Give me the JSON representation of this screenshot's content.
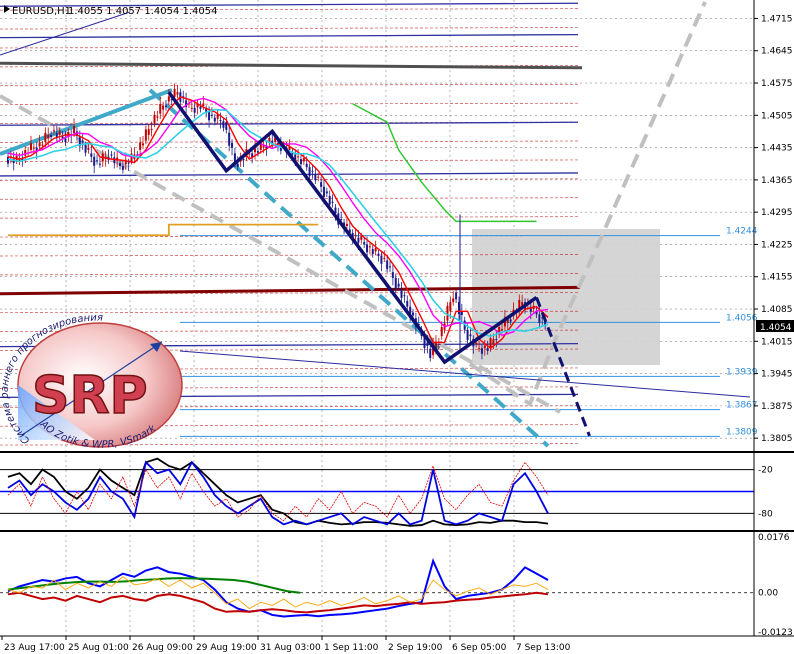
{
  "header": {
    "symbol": "EURUSD,H1",
    "ohlc": "1.4055 1.4057 1.4054 1.4054"
  },
  "logo": {
    "letters": "SRP",
    "arc_top": "Система раннего прогнозирования",
    "arc_bottom": "AO Zotik & WPR, VSmark"
  },
  "colors": {
    "background": "#ffffff",
    "grid": "#000000",
    "bull_candle": "#c00000",
    "bear_candle": "#1a1a8c",
    "price_fast_ma": "#ff0000",
    "price_slow_ma": "#ff00ff",
    "price_cyan_ma": "#2fd0e8",
    "zigzag": "#101070",
    "trend_dashed_blue": "#40a8c8",
    "trend_dashed_grey": "#c0c0c0",
    "step_line_green": "#2ec82e",
    "step_line_orange": "#e0a020",
    "resistance_brown": "#800000",
    "levels_red_dashed": "#c00000",
    "levels_blue": "#3030a0",
    "levels_light_blue": "#3090e0",
    "box": "#c8c8c8",
    "current_price_bg": "#000000",
    "current_price_text": "#ffffff",
    "wpr_black": "#000000",
    "wpr_blue": "#0000e0",
    "wpr_red": "#e00000",
    "osc_blue": "#0000ff",
    "osc_green": "#008000",
    "osc_red": "#c00000",
    "osc_orange": "#ffa500"
  },
  "chart_data": [
    {
      "type": "candlestick",
      "ylim": [
        1.3775,
        1.4755
      ],
      "y_ticks": [
        "1.4715",
        "1.4645",
        "1.4575",
        "1.4505",
        "1.4435",
        "1.4365",
        "1.4295",
        "1.4225",
        "1.4155",
        "1.4085",
        "1.4015",
        "1.3945",
        "1.3875",
        "1.3805"
      ],
      "x_ticks": [
        "23 Aug 17:00",
        "25 Aug 01:00",
        "26 Aug 09:00",
        "29 Aug 19:00",
        "31 Aug 03:00",
        "1 Sep 11:00",
        "2 Sep 19:00",
        "6 Sep 05:00",
        "7 Sep 13:00"
      ],
      "current_price": "1.4054",
      "level_labels": [
        {
          "label": "1.4244",
          "value": 1.4244
        },
        {
          "label": "1.4056",
          "value": 1.4056
        },
        {
          "label": "1.3939",
          "value": 1.3939
        },
        {
          "label": "1.3867",
          "value": 1.3867
        },
        {
          "label": "1.3809",
          "value": 1.3809
        }
      ],
      "resistance_level": {
        "from": 1.4118,
        "to": 1.4132
      },
      "long_term_line": {
        "from": 1.4618,
        "to": 1.4608
      },
      "price_path": [
        1.4415,
        1.4405,
        1.443,
        1.444,
        1.447,
        1.4455,
        1.447,
        1.443,
        1.44,
        1.442,
        1.4395,
        1.441,
        1.445,
        1.45,
        1.4535,
        1.4555,
        1.452,
        1.4525,
        1.45,
        1.449,
        1.44,
        1.442,
        1.443,
        1.445,
        1.444,
        1.442,
        1.44,
        1.437,
        1.433,
        1.428,
        1.425,
        1.423,
        1.421,
        1.419,
        1.414,
        1.409,
        1.404,
        1.3985,
        1.404,
        1.412,
        1.404,
        1.4,
        1.4,
        1.404,
        1.407,
        1.41,
        1.408,
        1.4054
      ],
      "zigzag": [
        {
          "bar": 14,
          "price": 1.4555
        },
        {
          "bar": 19,
          "price": 1.4385
        },
        {
          "bar": 23,
          "price": 1.447
        },
        {
          "bar": 38,
          "price": 1.397
        },
        {
          "bar": 46,
          "price": 1.411
        },
        {
          "bar": 48,
          "price": 1.381
        }
      ],
      "green_step_path": [
        {
          "bar": 30,
          "price": 1.453
        },
        {
          "bar": 33,
          "price": 1.449
        },
        {
          "bar": 34,
          "price": 1.443
        },
        {
          "bar": 36,
          "price": 1.436
        },
        {
          "bar": 38,
          "price": 1.43
        },
        {
          "bar": 39,
          "price": 1.4275
        },
        {
          "bar": 46,
          "price": 1.4275
        }
      ],
      "orange_step_path": [
        {
          "bar": 0,
          "price": 1.4245
        },
        {
          "bar": 14,
          "price": 1.4245
        },
        {
          "bar": 14,
          "price": 1.4268
        },
        {
          "bar": 27,
          "price": 1.4268
        }
      ]
    },
    {
      "type": "line",
      "name_pane": "wpr",
      "y_ticks": [
        "-20",
        "-80"
      ],
      "series": [
        {
          "color_key": "wpr_black",
          "values": [
            -30,
            -25,
            -40,
            -20,
            -30,
            -50,
            -60,
            -45,
            -20,
            -35,
            -45,
            -55,
            -10,
            -5,
            -15,
            -20,
            -10,
            -25,
            -40,
            -55,
            -65,
            -60,
            -55,
            -75,
            -80,
            -92,
            -95,
            -90,
            -93,
            -95,
            -94,
            -92,
            -92,
            -93,
            -95,
            -97,
            -96,
            -90,
            -95,
            -96,
            -95,
            -92,
            -93,
            -90,
            -90,
            -92,
            -92,
            -94
          ]
        },
        {
          "color_key": "wpr_blue",
          "values": [
            -45,
            -35,
            -55,
            -40,
            -50,
            -65,
            -75,
            -60,
            -30,
            -50,
            -60,
            -85,
            -10,
            -25,
            -20,
            -40,
            -10,
            -30,
            -55,
            -70,
            -80,
            -70,
            -60,
            -85,
            -95,
            -90,
            -95,
            -90,
            -85,
            -80,
            -95,
            -85,
            -90,
            -95,
            -80,
            -95,
            -90,
            -20,
            -90,
            -95,
            -90,
            -80,
            -85,
            -90,
            -40,
            -25,
            -50,
            -80
          ]
        },
        {
          "color_key": "wpr_red",
          "values": [
            -55,
            -40,
            -70,
            -30,
            -60,
            -80,
            -50,
            -75,
            -40,
            -60,
            -30,
            -70,
            -20,
            -45,
            -30,
            -60,
            -25,
            -50,
            -70,
            -60,
            -85,
            -75,
            -55,
            -80,
            -90,
            -70,
            -85,
            -60,
            -75,
            -50,
            -80,
            -65,
            -70,
            -85,
            -55,
            -80,
            -60,
            -15,
            -60,
            -75,
            -55,
            -40,
            -65,
            -70,
            -35,
            -10,
            -30,
            -55
          ]
        }
      ]
    },
    {
      "type": "line",
      "name_pane": "oscillator",
      "y_ticks": [
        "0.0176",
        "0.00",
        "-0.0123"
      ],
      "series": [
        {
          "color_key": "osc_blue",
          "values": [
            0.0005,
            0.002,
            0.003,
            0.004,
            0.0035,
            0.0045,
            0.005,
            0.003,
            0.002,
            0.004,
            0.006,
            0.005,
            0.007,
            0.008,
            0.0065,
            0.006,
            0.005,
            0.004,
            0.001,
            -0.003,
            -0.005,
            -0.006,
            -0.0055,
            -0.007,
            -0.0075,
            -0.0072,
            -0.007,
            -0.0074,
            -0.007,
            -0.0068,
            -0.0065,
            -0.006,
            -0.0055,
            -0.005,
            -0.0042,
            -0.0035,
            -0.003,
            0.01,
            0.002,
            -0.002,
            -0.001,
            -0.0005,
            0.0,
            0.001,
            0.004,
            0.008,
            0.006,
            0.004
          ]
        },
        {
          "color_key": "osc_green",
          "values": [
            0.001,
            0.0015,
            0.002,
            0.0025,
            0.003,
            0.0033,
            0.0035,
            0.0035,
            0.0034,
            0.0036,
            0.004,
            0.0042,
            0.0045,
            0.0046,
            0.0045,
            0.0044,
            0.0042,
            0.004,
            0.0035,
            0.0025,
            0.0015,
            0.0005,
            0.0
          ]
        },
        {
          "color_key": "osc_red",
          "values": [
            -0.0005,
            0.0,
            -0.001,
            -0.002,
            -0.0015,
            -0.0025,
            -0.001,
            -0.002,
            -0.003,
            -0.0015,
            -0.001,
            -0.002,
            -0.0025,
            -0.001,
            -0.0005,
            -0.001,
            -0.002,
            -0.003,
            -0.005,
            -0.006,
            -0.0058,
            -0.006,
            -0.0055,
            -0.0052,
            -0.0055,
            -0.006,
            -0.0062,
            -0.0058,
            -0.0055,
            -0.005,
            -0.0045,
            -0.004,
            -0.0042,
            -0.0038,
            -0.0035,
            -0.003,
            -0.0035,
            -0.0032,
            -0.003,
            -0.0025,
            -0.0022,
            -0.002,
            -0.0015,
            -0.0012,
            -0.0008,
            -0.0005,
            0.0,
            -0.0005
          ]
        },
        {
          "color_key": "osc_orange",
          "values": [
            0.001,
            0.0,
            0.002,
            0.0015,
            0.004,
            0.001,
            0.003,
            0.0015,
            0.0035,
            0.002,
            0.005,
            0.0025,
            0.003,
            0.0045,
            0.002,
            0.004,
            0.0015,
            0.003,
            0.0,
            -0.0035,
            -0.002,
            -0.005,
            -0.003,
            -0.004,
            -0.002,
            -0.0045,
            -0.003,
            -0.004,
            -0.0025,
            -0.004,
            -0.003,
            -0.0015,
            -0.0035,
            -0.0025,
            -0.001,
            -0.003,
            -0.002,
            0.004,
            0.001,
            -0.001,
            0.0005,
            0.0015,
            -0.0005,
            0.001,
            0.0025,
            0.002,
            0.003,
            0.001
          ]
        }
      ]
    }
  ]
}
